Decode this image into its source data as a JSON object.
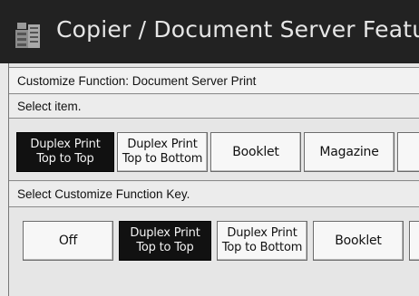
{
  "header": {
    "title": "Copier / Document Server Features",
    "icon": "copier-document-server-icon"
  },
  "panel": {
    "breadcrumb": "Customize Function: Document Server Print",
    "select_item_label": "Select item.",
    "select_key_label": "Select Customize Function Key."
  },
  "items": [
    {
      "label": "Duplex Print\nTop to Top",
      "selected": true
    },
    {
      "label": "Duplex Print\nTop to Bottom",
      "selected": false
    },
    {
      "label": "Booklet",
      "selected": false
    },
    {
      "label": "Magazine",
      "selected": false
    }
  ],
  "keys": [
    {
      "label": "Off",
      "selected": false
    },
    {
      "label": "Duplex Print\nTop to Top",
      "selected": true
    },
    {
      "label": "Duplex Print\nTop to Bottom",
      "selected": false
    },
    {
      "label": "Booklet",
      "selected": false
    }
  ],
  "colors": {
    "title_bar": "#222222",
    "selected_button": "#111111",
    "button": "#f7f7f7"
  }
}
